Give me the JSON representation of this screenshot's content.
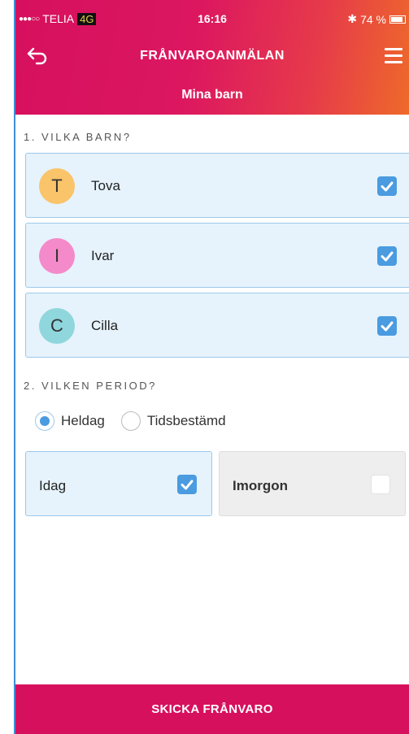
{
  "status_bar": {
    "signal": "●●●○○",
    "carrier": "TELIA",
    "network": "4G",
    "time": "16:16",
    "bluetooth": "✱",
    "battery": "74 %"
  },
  "nav": {
    "title": "FRÅNVAROANMÄLAN",
    "subtitle": "Mina barn"
  },
  "section_children": {
    "label": "1. VILKA BARN?",
    "children": [
      {
        "initial": "T",
        "name": "Tova",
        "checked": true,
        "avatar_color": "#f9c46a"
      },
      {
        "initial": "I",
        "name": "Ivar",
        "checked": true,
        "avatar_color": "#f48ac9"
      },
      {
        "initial": "C",
        "name": "Cilla",
        "checked": true,
        "avatar_color": "#8fd7dc"
      }
    ]
  },
  "section_period": {
    "label": "2. VILKEN PERIOD?",
    "options": [
      {
        "label": "Heldag",
        "selected": true
      },
      {
        "label": "Tidsbestämd",
        "selected": false
      }
    ],
    "days": [
      {
        "label": "Idag",
        "checked": true
      },
      {
        "label": "Imorgon",
        "checked": false
      }
    ]
  },
  "submit_label": "SKICKA FRÅNVARO",
  "colors": {
    "brand": "#d7105e",
    "accent": "#4a9be0",
    "selected_bg": "#e6f3fc"
  }
}
